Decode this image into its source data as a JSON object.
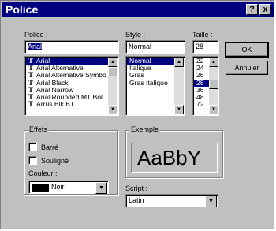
{
  "window": {
    "title": "Police",
    "help_btn": "?",
    "close_btn": "x"
  },
  "font": {
    "label": "Police :",
    "value": "Arial",
    "items": [
      {
        "name": "Arial",
        "selected": true
      },
      {
        "name": "Arial Alternative",
        "selected": false
      },
      {
        "name": "Arial Alternative Symbo",
        "selected": false
      },
      {
        "name": "Arial Black",
        "selected": false
      },
      {
        "name": "Arial Narrow",
        "selected": false
      },
      {
        "name": "Arial Rounded MT Bol",
        "selected": false
      },
      {
        "name": "Arrus Blk BT",
        "selected": false
      }
    ],
    "icon": "truetype-icon"
  },
  "style": {
    "label": "Style :",
    "value": "Normal",
    "items": [
      {
        "name": "Normal",
        "selected": true
      },
      {
        "name": "Italique",
        "selected": false
      },
      {
        "name": "Gras",
        "selected": false
      },
      {
        "name": "Gras Italique",
        "selected": false
      }
    ]
  },
  "size": {
    "label": "Taille :",
    "value": "28",
    "items": [
      {
        "name": "22",
        "selected": false
      },
      {
        "name": "24",
        "selected": false
      },
      {
        "name": "26",
        "selected": false
      },
      {
        "name": "28",
        "selected": true
      },
      {
        "name": "36",
        "selected": false
      },
      {
        "name": "48",
        "selected": false
      },
      {
        "name": "72",
        "selected": false
      }
    ]
  },
  "buttons": {
    "ok": "OK",
    "cancel": "Annuler"
  },
  "effects": {
    "label": "Effets",
    "strike": "Barré",
    "strike_checked": false,
    "underline": "Souligné",
    "underline_checked": false,
    "color_label": "Couleur :",
    "color_value": "Noir",
    "color_hex": "#000000"
  },
  "sample": {
    "label": "Exemple",
    "text": "AaBbY"
  },
  "script": {
    "label": "Script :",
    "value": "Latin"
  },
  "colors": {
    "title_bg": "#000080",
    "dialog_bg": "#c0c0c0",
    "selection": "#000080"
  }
}
